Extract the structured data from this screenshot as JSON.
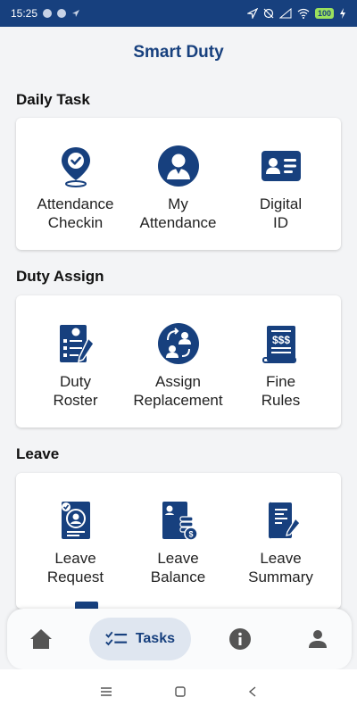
{
  "status": {
    "time": "15:25",
    "battery": "100"
  },
  "app": {
    "title": "Smart Duty"
  },
  "sections": [
    {
      "title": "Daily Task",
      "items": [
        {
          "line1": "Attendance",
          "line2": "Checkin",
          "icon": "location-check-icon"
        },
        {
          "line1": "My",
          "line2": "Attendance",
          "icon": "user-avatar-icon"
        },
        {
          "line1": "Digital",
          "line2": "ID",
          "icon": "id-card-icon"
        }
      ]
    },
    {
      "title": "Duty Assign",
      "items": [
        {
          "line1": "Duty",
          "line2": "Roster",
          "icon": "roster-document-icon"
        },
        {
          "line1": "Assign",
          "line2": "Replacement",
          "icon": "replacement-icon"
        },
        {
          "line1": "Fine",
          "line2": "Rules",
          "icon": "fine-rules-icon"
        }
      ]
    },
    {
      "title": "Leave",
      "items": [
        {
          "line1": "Leave",
          "line2": "Request",
          "icon": "leave-request-icon"
        },
        {
          "line1": "Leave",
          "line2": "Balance",
          "icon": "leave-balance-icon"
        },
        {
          "line1": "Leave",
          "line2": "Summary",
          "icon": "leave-summary-icon"
        }
      ]
    }
  ],
  "nav": {
    "active_label": "Tasks"
  },
  "colors": {
    "primary": "#17407e",
    "background": "#f3f4f6"
  }
}
